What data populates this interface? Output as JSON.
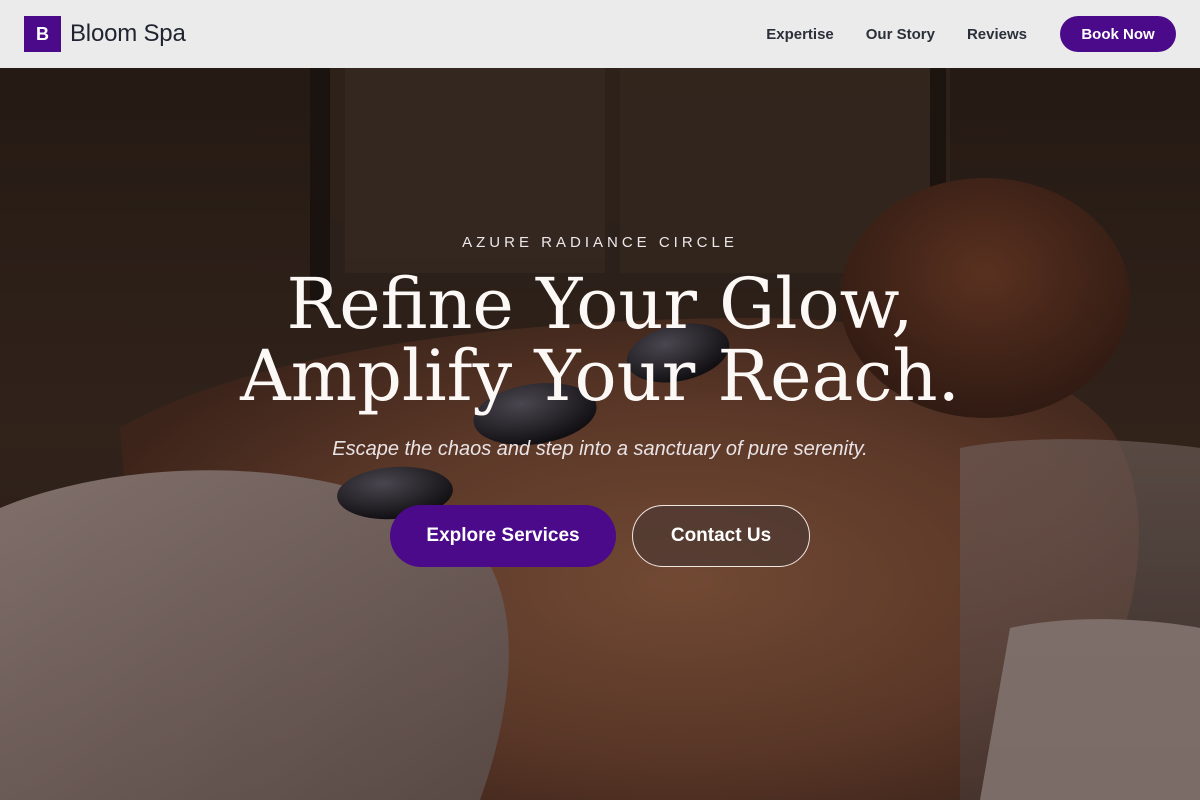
{
  "header": {
    "logo_letter": "B",
    "brand_name": "Bloom Spa",
    "nav": [
      "Expertise",
      "Our Story",
      "Reviews"
    ],
    "book_label": "Book Now"
  },
  "hero": {
    "eyebrow": "AZURE RADIANCE CIRCLE",
    "headline_line1": "Refine Your Glow,",
    "headline_line2": "Amplify Your Reach.",
    "subtitle": "Escape the chaos and step into a sanctuary of pure serenity.",
    "primary_cta": "Explore Services",
    "secondary_cta": "Contact Us",
    "background_image": "massage-with-hot-stones-photo"
  },
  "colors": {
    "brand_purple": "#4b0a8a",
    "header_bg": "#ebebeb",
    "hero_text": "#ffffff"
  }
}
